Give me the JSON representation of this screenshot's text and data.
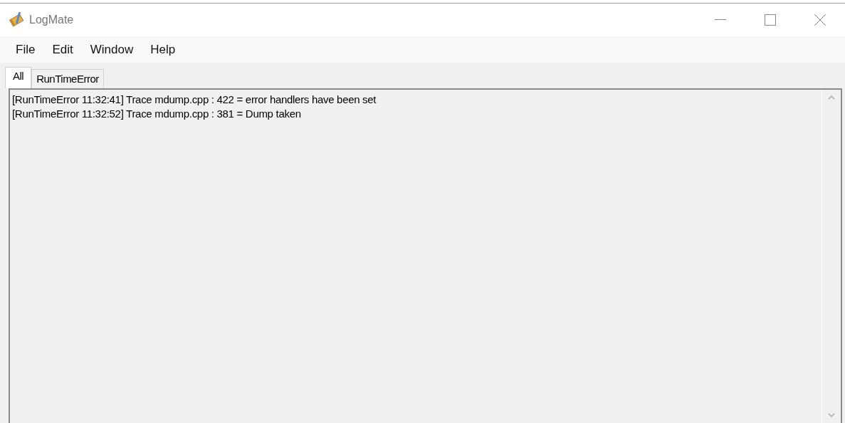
{
  "window": {
    "title": "LogMate"
  },
  "menu": [
    "File",
    "Edit",
    "Window",
    "Help"
  ],
  "tabs": [
    {
      "label": "All",
      "selected": true
    },
    {
      "label": "RunTimeError",
      "selected": false
    }
  ],
  "log_lines": [
    "[RunTimeError 11:32:41] Trace mdump.cpp : 422 = error handlers have been set",
    "[RunTimeError 11:32:52] Trace mdump.cpp : 381 = Dump taken"
  ]
}
